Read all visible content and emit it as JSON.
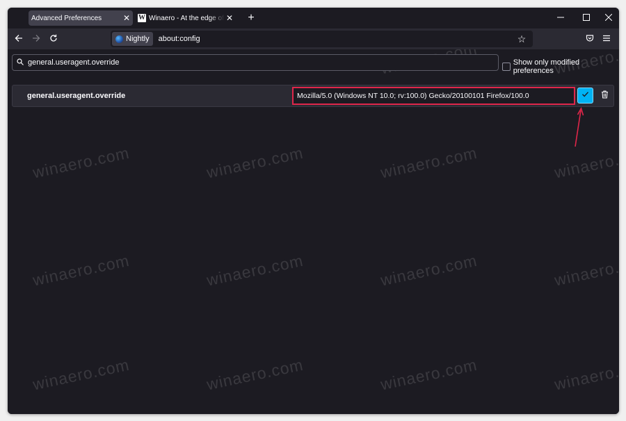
{
  "tabs": [
    {
      "title": "Advanced Preferences",
      "active": true
    },
    {
      "title": "Winaero - At the edge of tweaking",
      "active": false,
      "favicon": "W"
    }
  ],
  "toolbar": {
    "identity_label": "Nightly",
    "url": "about:config"
  },
  "config": {
    "search_value": "general.useragent.override",
    "modified_checkbox_label": "Show only modified preferences",
    "modified_checked": false,
    "pref": {
      "name": "general.useragent.override",
      "value": "Mozilla/5.0 (Windows NT 10.0; rv:100.0) Gecko/20100101 Firefox/100.0"
    }
  },
  "watermark": "winaero.com",
  "colors": {
    "accent": "#00b3f4",
    "highlight": "#e0264a",
    "background": "#1c1b22",
    "toolbar": "#2b2a33"
  },
  "icons": [
    "new-tab-icon",
    "minimize-icon",
    "maximize-icon",
    "close-icon",
    "back-icon",
    "forward-icon",
    "reload-icon",
    "bookmark-star-icon",
    "pocket-icon",
    "menu-icon",
    "search-icon",
    "check-icon",
    "trash-icon",
    "arrow-icon"
  ]
}
